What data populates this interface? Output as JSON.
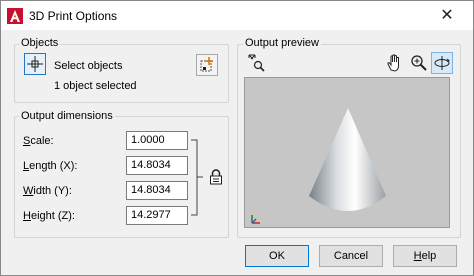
{
  "window": {
    "title": "3D Print Options",
    "close_glyph": "✕"
  },
  "objects": {
    "group_label": "Objects",
    "select_label": "Select objects",
    "status": "1 object selected",
    "select_icon": "select-objects-icon",
    "quick_select_icon": "quick-select-icon"
  },
  "output_dimensions": {
    "group_label": "Output dimensions",
    "fields": [
      {
        "hotkey": "S",
        "label_rest": "cale:",
        "value": "1.0000"
      },
      {
        "hotkey": "L",
        "label_rest": "ength (X):",
        "value": "14.8034"
      },
      {
        "hotkey": "W",
        "label_rest": "idth (Y):",
        "value": "14.8034"
      },
      {
        "hotkey": "H",
        "label_rest": "eight (Z):",
        "value": "14.2977"
      }
    ],
    "lock_icon": "lock-icon"
  },
  "output_preview": {
    "group_label": "Output preview",
    "tools": [
      "zoom-extents-icon",
      "pan-hand-icon",
      "zoom-icon",
      "orbit-icon"
    ],
    "background": "#c6c6c6",
    "model": "cone"
  },
  "buttons": {
    "ok": "OK",
    "cancel": "Cancel",
    "help_hotkey": "H",
    "help_rest": "elp"
  },
  "colors": {
    "accent": "#0078d7",
    "app_red": "#c8102e"
  }
}
